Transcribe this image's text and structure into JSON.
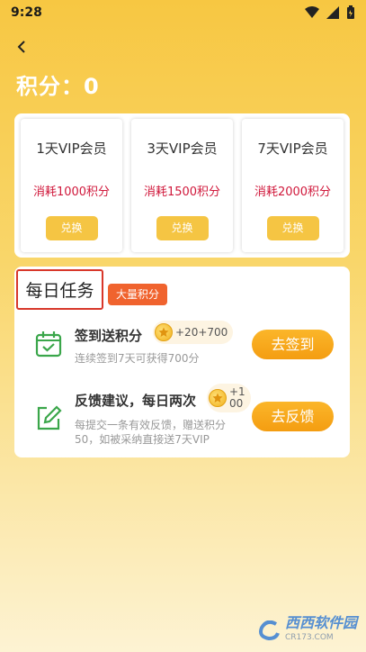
{
  "status_bar": {
    "time": "9:28"
  },
  "header": {
    "title": "积分：0"
  },
  "vip_options": [
    {
      "name": "1天VIP会员",
      "cost": "消耗1000积分",
      "button": "兑换"
    },
    {
      "name": "3天VIP会员",
      "cost": "消耗1500积分",
      "button": "兑换"
    },
    {
      "name": "7天VIP会员",
      "cost": "消耗2000积分",
      "button": "兑换"
    }
  ],
  "daily_tasks": {
    "title": "每日任务",
    "tag": "大量积分",
    "items": [
      {
        "name": "签到送积分",
        "reward": "+20+700",
        "desc": "连续签到7天可获得700分",
        "button": "去签到",
        "icon": "calendar-check-icon"
      },
      {
        "name": "反馈建议，每日两次",
        "reward_line1": "+1",
        "reward_line2": "00",
        "desc_line1": "每提交一条有效反馈，赠送积分",
        "desc_line2": "50，如被采纳直接送7天VIP",
        "button": "去反馈",
        "icon": "edit-icon"
      }
    ]
  },
  "watermark": {
    "text": "西西软件园",
    "sub": "CR173.COM"
  },
  "colors": {
    "accent": "#f5c543",
    "button": "#f49d11",
    "cost_red": "#d0183b",
    "tag_orange": "#f0632e"
  }
}
